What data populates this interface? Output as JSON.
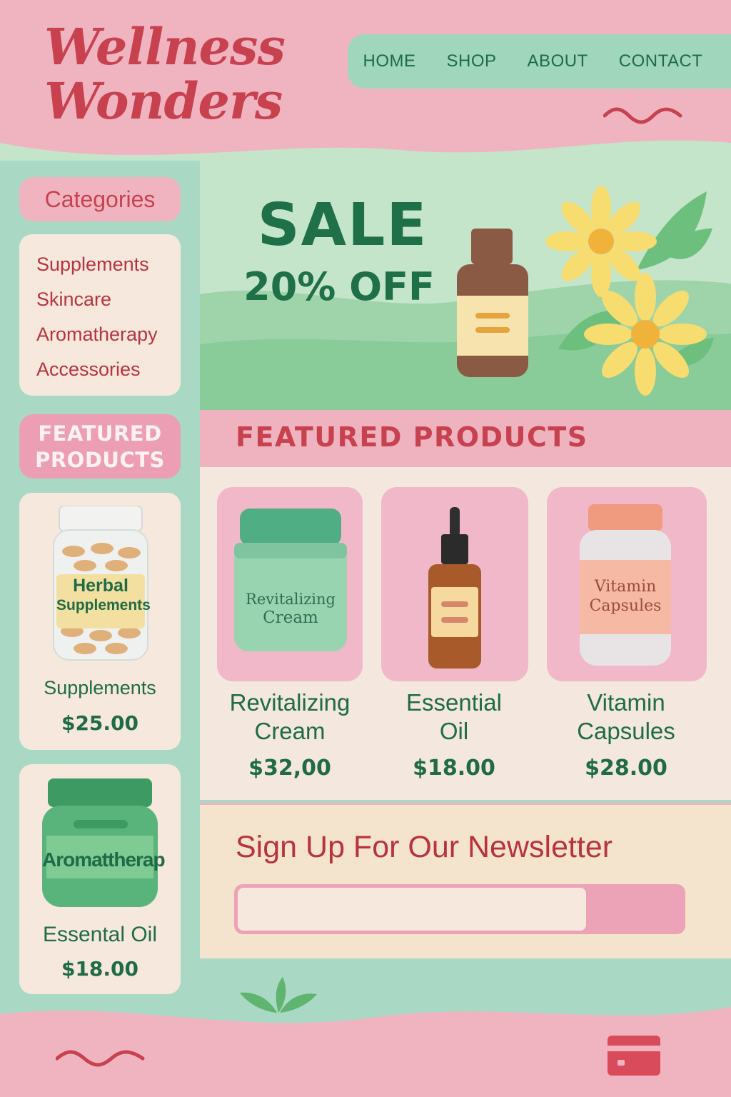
{
  "brand": {
    "line1": "Wellness",
    "line2": "Wonders"
  },
  "nav": {
    "items": [
      "HOME",
      "SHOP",
      "ABOUT",
      "CONTACT"
    ]
  },
  "sidebar": {
    "categories_title": "Categories",
    "categories": [
      "Supplements",
      "Skincare",
      "Aromatherapy",
      "Accessories"
    ],
    "featured_title_line1": "FEATURED",
    "featured_title_line2": "PRODUCTS",
    "cards": [
      {
        "label": "Herbal Supplements",
        "label_line1": "Herbal",
        "label_line2": "Supplements",
        "name": "Supplements",
        "price": "$25.00"
      },
      {
        "label": "Aromattherap",
        "name": "Essental Oil",
        "price": "$18.00"
      }
    ]
  },
  "hero": {
    "title": "SALE",
    "subtitle": "20% OFF"
  },
  "featured": {
    "title": "FEATURED PRODUCTS",
    "products": [
      {
        "jar_label_line1": "Revitalizing",
        "jar_label_line2": "Cream",
        "name_line1": "Revitalizing",
        "name_line2": "Cream",
        "price": "$32,00"
      },
      {
        "name_line1": "Essential",
        "name_line2": "Oil",
        "price": "$18.00"
      },
      {
        "jar_label_line1": "Vitamin",
        "jar_label_line2": "Capsules",
        "name_line1": "Vitamin",
        "name_line2": "Capsules",
        "price": "$28.00"
      }
    ]
  },
  "newsletter": {
    "title": "Sign Up For Our Newsletter",
    "input_value": "",
    "placeholder": ""
  },
  "icons": [
    "wave-icon",
    "flower-icon",
    "bottle-icon",
    "jar-icon",
    "dropper-bottle-icon",
    "capsule-bottle-icon",
    "leaf-icon",
    "card-icon"
  ],
  "colors": {
    "pink": "#f0b4c1",
    "mint": "#a9d9c4",
    "green_text": "#1f6b47",
    "red_text": "#c8414f",
    "cream": "#f6e8dc",
    "yellow": "#f7dc6f"
  }
}
